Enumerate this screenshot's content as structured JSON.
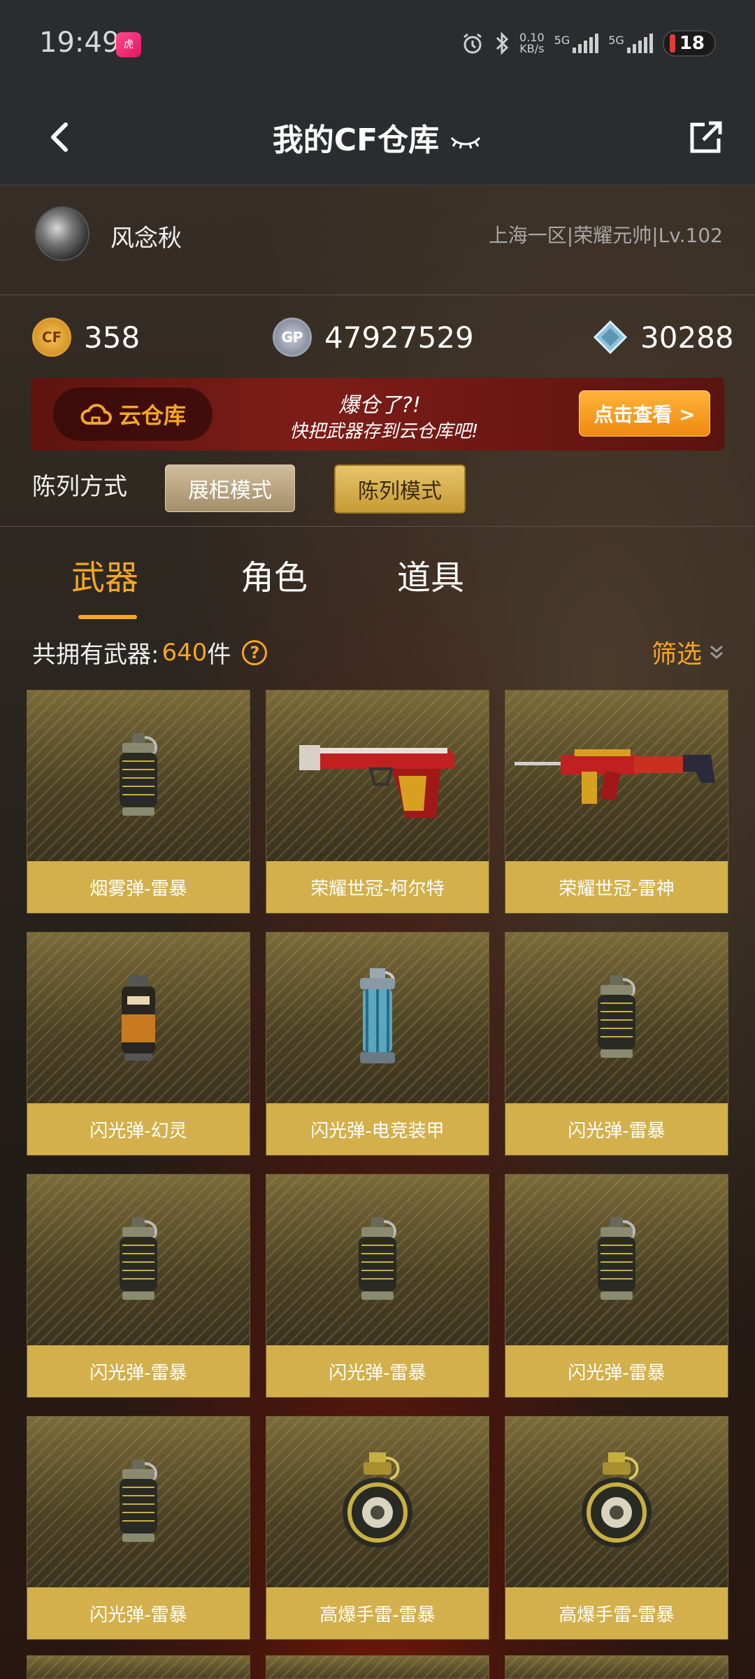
{
  "status_bar": {
    "time": "19:49",
    "app_icon": "huya-app-icon",
    "speed_value": "0.10",
    "speed_unit": "KB/s",
    "net1": "5G",
    "net2": "5G",
    "battery": "18"
  },
  "header": {
    "title": "我的CF仓库",
    "back_icon": "back-arrow-icon",
    "share_icon": "share-icon"
  },
  "profile": {
    "name": "风念秋",
    "info": "上海一区|荣耀元帅|Lv.102"
  },
  "currency": {
    "cf_points": "358",
    "gp": "47927529",
    "diamonds": "30288"
  },
  "banner": {
    "cloud_label": "云仓库",
    "slogan_line1": "爆仓了?!",
    "slogan_line2": "快把武器存到云仓库吧!",
    "button": "点击查看 >"
  },
  "display": {
    "label": "陈列方式",
    "mode_showcase": "展柜模式",
    "mode_display": "陈列模式"
  },
  "tabs": [
    {
      "label": "武器",
      "active": true
    },
    {
      "label": "角色",
      "active": false
    },
    {
      "label": "道具",
      "active": false
    }
  ],
  "summary": {
    "prefix": "共拥有武器:",
    "count": "640",
    "suffix": "件",
    "filter": "筛选"
  },
  "items": [
    {
      "name": "烟雾弹-雷暴",
      "art": "grenade-dark"
    },
    {
      "name": "荣耀世冠-柯尔特",
      "art": "pistol"
    },
    {
      "name": "荣耀世冠-雷神",
      "art": "rifle"
    },
    {
      "name": "闪光弹-幻灵",
      "art": "grenade-orange"
    },
    {
      "name": "闪光弹-电竞装甲",
      "art": "grenade-blue"
    },
    {
      "name": "闪光弹-雷暴",
      "art": "grenade-dark"
    },
    {
      "name": "闪光弹-雷暴",
      "art": "grenade-dark"
    },
    {
      "name": "闪光弹-雷暴",
      "art": "grenade-dark"
    },
    {
      "name": "闪光弹-雷暴",
      "art": "grenade-dark"
    },
    {
      "name": "闪光弹-雷暴",
      "art": "grenade-dark"
    },
    {
      "name": "高爆手雷-雷暴",
      "art": "grenade-round"
    },
    {
      "name": "高爆手雷-雷暴",
      "art": "grenade-round"
    }
  ],
  "colors": {
    "accent": "#f5a623",
    "card_label": "#d3b04b",
    "header_bg": "#2b2c30"
  }
}
